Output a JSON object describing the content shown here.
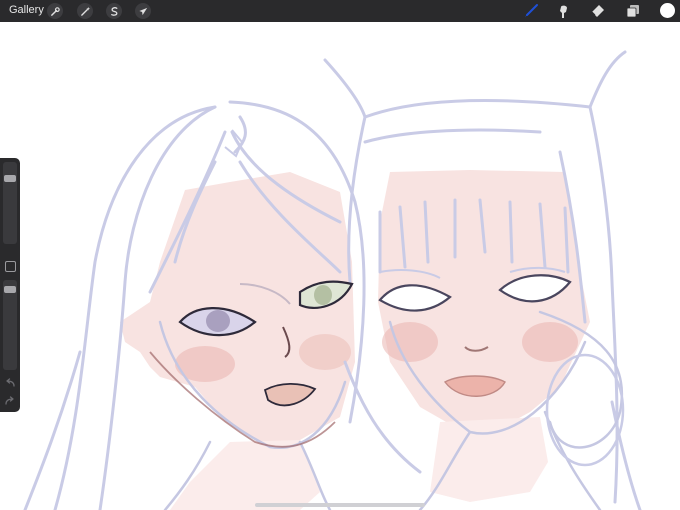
{
  "toolbar": {
    "gallery_label": "Gallery",
    "left_icons": [
      "wrench-icon",
      "magic-wand-icon",
      "selection-icon",
      "transform-arrow-icon"
    ],
    "right_icons": [
      "brush-icon",
      "smudge-icon",
      "eraser-icon",
      "layers-icon"
    ],
    "active_tool": "brush",
    "active_color": "#1f4fd6",
    "current_color": "#ffffff"
  },
  "sidebar": {
    "brush_size_level": 0.15,
    "opacity_level": 0.05,
    "controls": [
      "brush-size-slider",
      "modify-button",
      "opacity-slider",
      "undo-arrow-icon",
      "redo-arrow-icon"
    ]
  },
  "canvas": {
    "background": "#ffffff",
    "line_color": "#c9cbe6",
    "skin_color": "#f8e3e1",
    "blush_color": "#e9b5b0"
  }
}
